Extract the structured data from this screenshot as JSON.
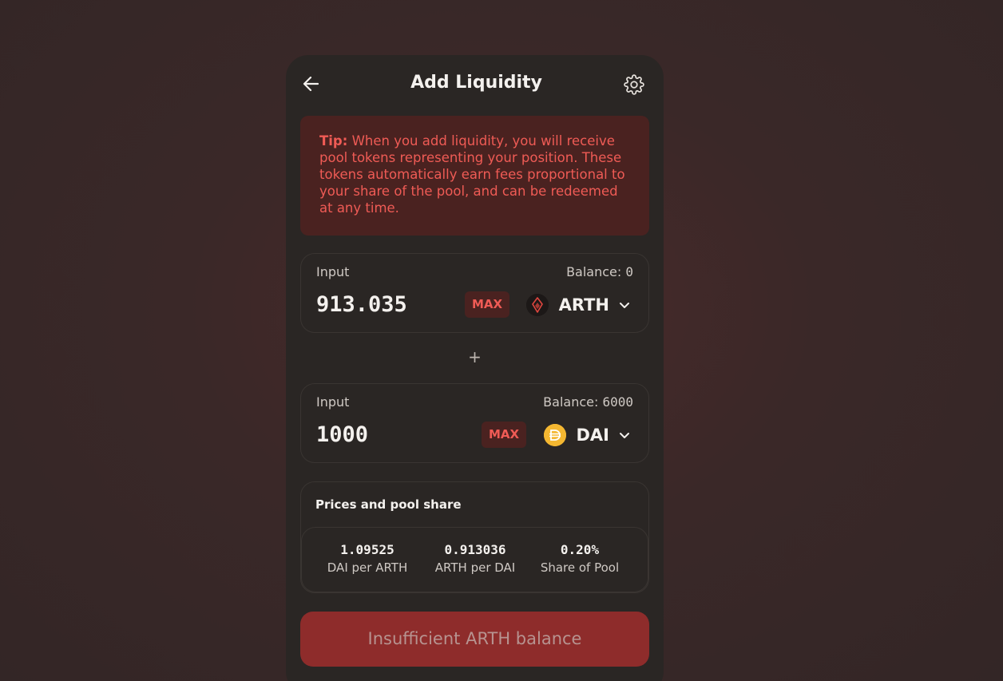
{
  "header": {
    "title": "Add Liquidity",
    "back_icon": "arrow-left-icon",
    "settings_icon": "gear-icon"
  },
  "tip": {
    "label": "Tip:",
    "text": " When you add liquidity, you will receive pool tokens representing your position. These tokens automatically earn fees proportional to your share of the pool, and can be redeemed at any time."
  },
  "input_a": {
    "label": "Input",
    "balance_label": "Balance: ",
    "balance_value": "0",
    "amount": "913.035",
    "max_label": "MAX",
    "token": "ARTH",
    "token_icon": "arth-token-icon"
  },
  "plus_symbol": "+",
  "input_b": {
    "label": "Input",
    "balance_label": "Balance: ",
    "balance_value": "6000",
    "amount": "1000",
    "max_label": "MAX",
    "token": "DAI",
    "token_icon": "dai-token-icon"
  },
  "prices": {
    "title": "Prices and pool share",
    "items": [
      {
        "value": "1.09525",
        "label": "DAI per ARTH"
      },
      {
        "value": "0.913036",
        "label": "ARTH per DAI"
      },
      {
        "value": "0.20%",
        "label": "Share of Pool"
      }
    ]
  },
  "submit": {
    "label": "Insufficient ARTH balance"
  },
  "colors": {
    "accent": "#ef5b55",
    "card": "#2a2624",
    "button_disabled": "#8e2c2b"
  }
}
